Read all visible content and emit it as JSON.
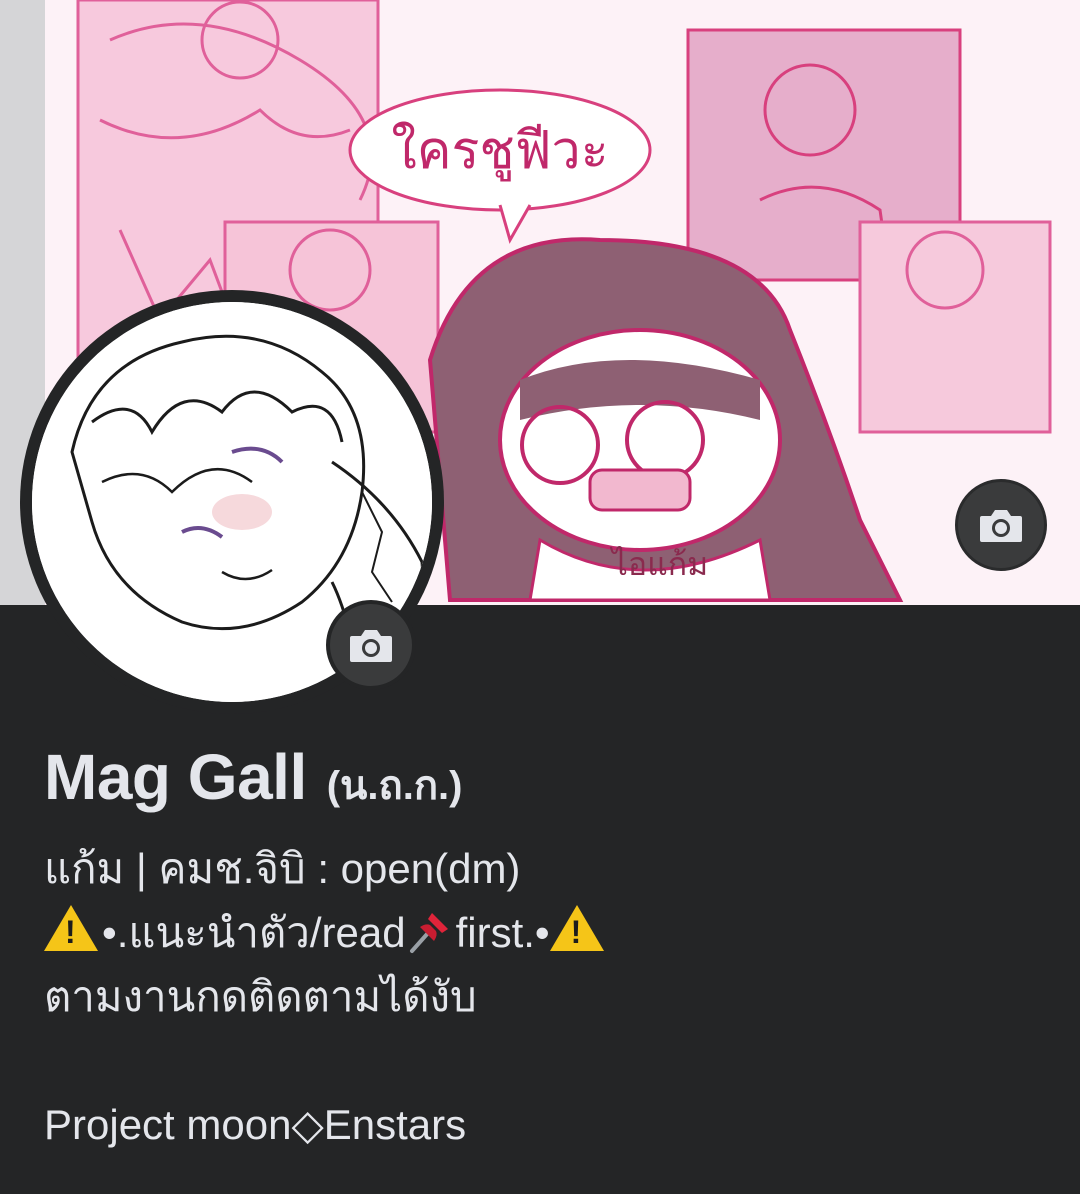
{
  "profile": {
    "name": "Mag Gall",
    "alternate_name": "(น.ถ.ก.)",
    "bio": {
      "line1": "แก้ม | คมช.จิบิ : open(dm)",
      "line2_part1": "•.แนะนำตัว/read",
      "line2_part2": "first.•",
      "line3": "ตามงานกดติดตามได้งับ",
      "line5": "Project moon◇Enstars"
    },
    "cover_art_text": {
      "speech": "ใครชูฟีวะ",
      "shirt": "ไอแก้ม"
    }
  },
  "icons": {
    "cover_camera": "camera-icon",
    "avatar_camera": "camera-icon",
    "warning": "warning-icon",
    "pin": "pushpin-icon"
  },
  "colors": {
    "background": "#242526",
    "text": "#e4e6eb",
    "camera_button": "#3a3b3c",
    "cover_pink": "#e85a9b",
    "warning": "#f5c518",
    "pin": "#e0243a"
  }
}
